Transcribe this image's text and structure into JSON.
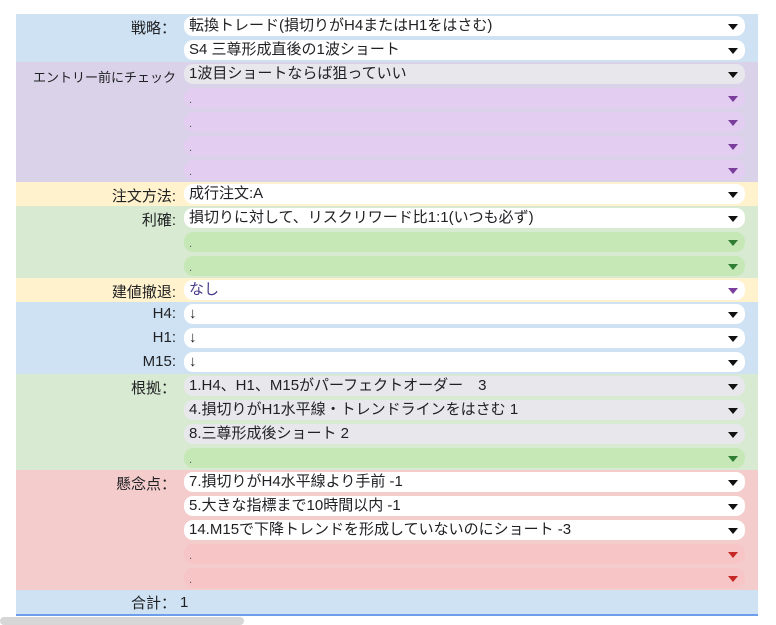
{
  "strategy": {
    "label": "戦略：",
    "values": [
      "転換トレード(損切りがH4またはH1をはさむ)",
      "S4 三尊形成直後の1波ショート"
    ]
  },
  "pre_entry_check": {
    "label": "エントリー前にチェック",
    "values": [
      "1波目ショートならば狙っていい",
      ".",
      ".",
      ".",
      "."
    ]
  },
  "order_method": {
    "label": "注文方法:",
    "value": "成行注文:A"
  },
  "take_profit": {
    "label": "利確:",
    "values": [
      "損切りに対して、リスクリワード比1:1(いつも必ず)",
      ".",
      "."
    ]
  },
  "withdrawal": {
    "label": "建値撤退:",
    "value": "なし"
  },
  "h4": {
    "label": "H4:",
    "value": "↓"
  },
  "h1": {
    "label": "H1:",
    "value": "↓"
  },
  "m15": {
    "label": "M15:",
    "value": "↓"
  },
  "basis": {
    "label": "根拠：",
    "values": [
      "1.H4、H1、M15がパーフェクトオーダー　3",
      "4.損切りがH1水平線・トレンドラインをはさむ 1",
      "8.三尊形成後ショート 2",
      "."
    ]
  },
  "concerns": {
    "label": "懸念点：",
    "values": [
      "7.損切りがH4水平線より手前 -1",
      "5.大きな指標まで10時間以内 -1",
      "14.M15で下降トレンドを形成していないのにショート -3",
      ".",
      "."
    ]
  },
  "total": {
    "label": "合計：",
    "value": "1"
  },
  "colors": {
    "blue_section": "#cfe2f3",
    "purple_section": "#d9d2e9",
    "yellow_section": "#fff2cc",
    "green_section": "#d9ead3",
    "pink_section": "#f4cccc"
  }
}
